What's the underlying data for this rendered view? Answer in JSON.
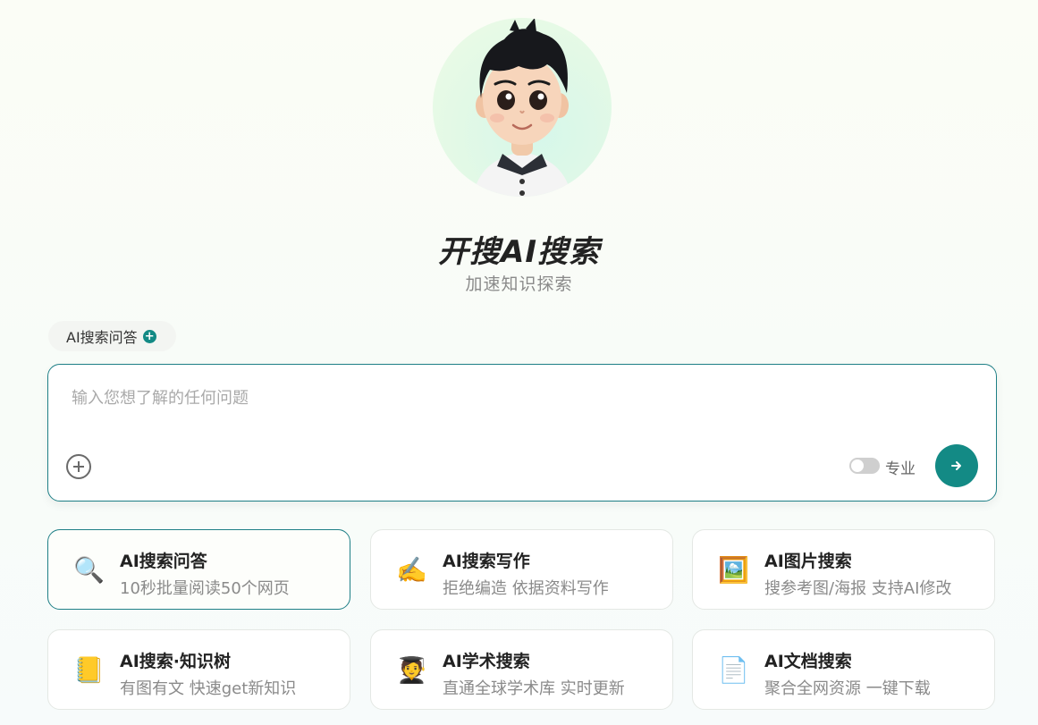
{
  "brand": {
    "title": "开搜AI搜索",
    "subtitle": "加速知识探索"
  },
  "mode_tag": {
    "label": "AI搜索问答",
    "plus": "+"
  },
  "search": {
    "placeholder": "输入您想了解的任何问题",
    "pro_label": "专业",
    "pro_enabled": false
  },
  "cards": [
    {
      "title": "AI搜索问答",
      "subtitle": "10秒批量阅读50个网页",
      "icon": "🔍"
    },
    {
      "title": "AI搜索写作",
      "subtitle": "拒绝编造 依据资料写作",
      "icon": "✍️"
    },
    {
      "title": "AI图片搜索",
      "subtitle": "搜参考图/海报 支持AI修改",
      "icon": "🖼️"
    },
    {
      "title": "AI搜索·知识树",
      "subtitle": "有图有文 快速get新知识",
      "icon": "📒"
    },
    {
      "title": "AI学术搜索",
      "subtitle": "直通全球学术库 实时更新",
      "icon": "🧑‍🎓"
    },
    {
      "title": "AI文档搜索",
      "subtitle": "聚合全网资源 一键下载",
      "icon": "📄"
    }
  ],
  "colors": {
    "accent": "#138a85",
    "border_active": "#1e7f86"
  }
}
